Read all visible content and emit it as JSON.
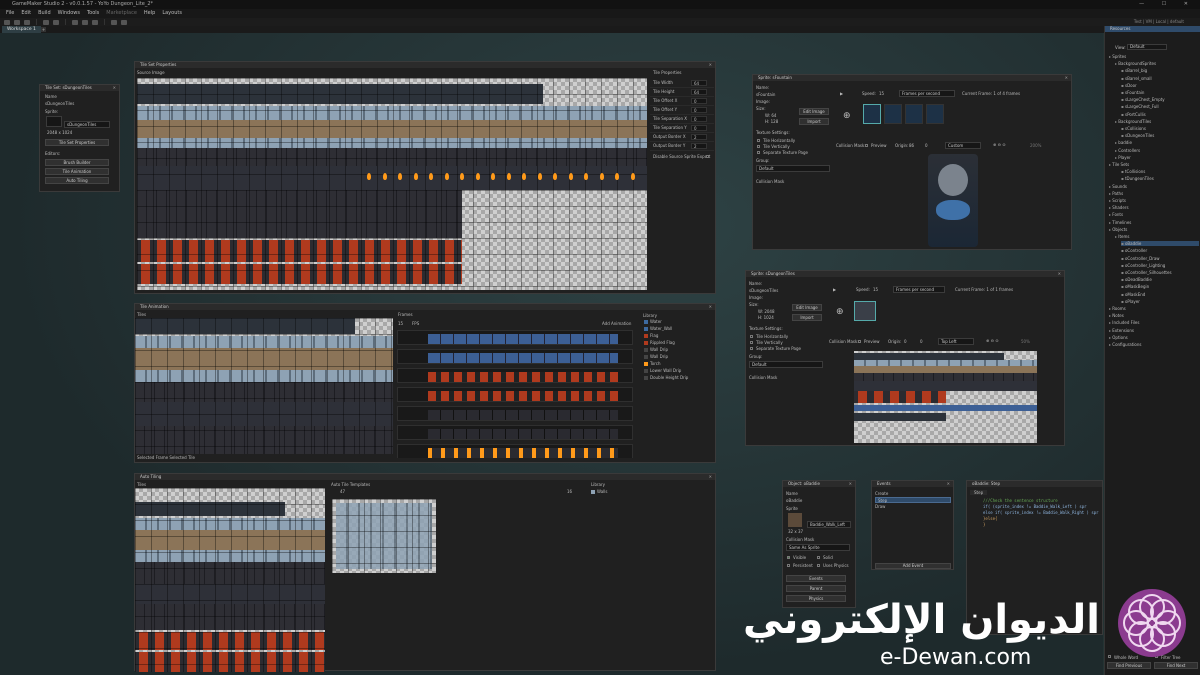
{
  "app": {
    "title": "GameMaker Studio 2 - v0.0.1.57 - YoYo Dungeon_Lite_2*",
    "window_controls": "— ☐ ✕",
    "right_info": "Test | VM | Local | default"
  },
  "menu": [
    "File",
    "Edit",
    "Build",
    "Windows",
    "Tools",
    "Marketplace",
    "Help",
    "Layouts"
  ],
  "workspace_tab": "Workspace 1",
  "tile_set": {
    "title": "Tile Set: sDungeonTiles",
    "name_label": "Name",
    "name": "sDungeonTiles",
    "sprite_label": "Sprite:",
    "sprite_value": "sDungeonTiles",
    "size": "2048 x 1024",
    "props_button": "Tile Set Properties",
    "editors_label": "Editors:",
    "editors": [
      "Brush Builder",
      "Tile Animation",
      "Auto Tiling"
    ]
  },
  "tsprops": {
    "title": "Tile Set Properties",
    "source_label": "Source Image",
    "props_header": "Tile Properties",
    "props": [
      {
        "label": "Tile Width",
        "value": "64"
      },
      {
        "label": "Tile Height",
        "value": "64"
      },
      {
        "label": "Tile Offset X",
        "value": "0"
      },
      {
        "label": "Tile Offset Y",
        "value": "0"
      },
      {
        "label": "Tile Separation X",
        "value": "0"
      },
      {
        "label": "Tile Separation Y",
        "value": "0"
      },
      {
        "label": "Output Border X",
        "value": "2"
      },
      {
        "label": "Output Border Y",
        "value": "2"
      }
    ],
    "disable_label": "Disable Source Sprite Export"
  },
  "tileanim": {
    "title": "Tile Animation",
    "tiles_label": "Tiles",
    "frames_label": "Frames",
    "fps_value": "15",
    "fps_label": "FPS",
    "add_anim": "Add Animation",
    "library_label": "Library",
    "library": [
      "Water",
      "Water_Wall",
      "Flag",
      "Rippled Flag",
      "Wall Drip",
      "Wall Drip",
      "Torch",
      "Lower Wall Drip",
      "Double Height Drip"
    ],
    "footer": "Selected Frame   Selected Tile"
  },
  "autotile": {
    "title": "Auto Tiling",
    "tiles_label": "Tiles",
    "templates_label": "Auto Tile Templates",
    "library_label": "Library",
    "library": [
      "Walls"
    ],
    "count_a": "47",
    "count_b": "16"
  },
  "sprite_fountain": {
    "title": "Sprite: sFountain",
    "name_label": "Name:",
    "name": "sFountain",
    "image_label": "Image:",
    "size_label": "Size:",
    "w": "W: 64",
    "h": "H: 128",
    "edit_button": "Edit Image",
    "import_button": "Import",
    "texture_label": "Texture Settings:",
    "texture_opts": [
      "Tile Horizontally",
      "Tile Vertically",
      "Separate Texture Page"
    ],
    "group_label": "Group:",
    "group_value": "Default",
    "collision_label": "Collision Mask",
    "speed_label": "Speed:",
    "speed_value": "15",
    "speed_unit": "Frames per second",
    "current_frame": "Current Frame: 1 of 4 frames",
    "coll_mask": "Collision Mask:",
    "preview": "Preview",
    "origin": "Origin:",
    "ox": "86",
    "oy": "0",
    "origin_mode": "Custom",
    "zoom": "200%"
  },
  "sprite_tiles": {
    "title": "Sprite: sDungeonTiles",
    "name_label": "Name:",
    "name": "sDungeonTiles",
    "image_label": "Image:",
    "size_label": "Size:",
    "w": "W: 2048",
    "h": "H: 1024",
    "edit_button": "Edit Image",
    "import_button": "Import",
    "texture_label": "Texture Settings:",
    "texture_opts": [
      "Tile Horizontally",
      "Tile Vertically",
      "Separate Texture Page"
    ],
    "group_label": "Group:",
    "group_value": "Default",
    "collision_label": "Collision Mask",
    "speed_label": "Speed:",
    "speed_value": "15",
    "speed_unit": "Frames per second",
    "current_frame": "Current Frame: 1 of 1 frames",
    "coll_mask": "Collision Mask:",
    "preview": "Preview",
    "origin": "Origin:",
    "ox": "0",
    "oy": "0",
    "origin_mode": "Top Left",
    "zoom": "50%"
  },
  "object": {
    "title": "Object: oBaddie",
    "name_label": "Name",
    "name": "oBaddie",
    "sprite_label": "Sprite",
    "sprite_value": "Baddie_Walk_Left",
    "size": "32 x 37",
    "mask_label": "Collision Mask",
    "mask_value": "Same As Sprite",
    "checks": [
      "Visible",
      "Solid",
      "Persistent",
      "Uses Physics"
    ],
    "buttons": [
      "Events",
      "Parent",
      "Physics"
    ]
  },
  "events": {
    "title": "Events",
    "items": [
      "Create",
      "Step",
      "Draw"
    ],
    "add_button": "Add Event"
  },
  "code": {
    "title": "oBaddie: Step",
    "tab": "Step",
    "lines": [
      "///Check the sentence structure",
      "if(   (sprite_index != Baddie_Walk_Left ) spr",
      "else if(  sprite_index != Baddie_Walk_Right ) spr",
      "}else{",
      "}"
    ]
  },
  "resources": {
    "header": "Resources",
    "view_label": "View:",
    "view_value": "Default",
    "items": [
      {
        "t": "Sprites",
        "i": 0
      },
      {
        "t": "BackgroundSprites",
        "i": 1
      },
      {
        "t": "sBarrel_big",
        "i": 2
      },
      {
        "t": "sBarrel_small",
        "i": 2
      },
      {
        "t": "sDoor",
        "i": 2
      },
      {
        "t": "sFountain",
        "i": 2
      },
      {
        "t": "sLargeChest_Empty",
        "i": 2
      },
      {
        "t": "sLargeChest_Full",
        "i": 2
      },
      {
        "t": "sPortCullis",
        "i": 2
      },
      {
        "t": "BackgroundTiles",
        "i": 1
      },
      {
        "t": "sCollisions",
        "i": 2
      },
      {
        "t": "sDungeonTiles",
        "i": 2
      },
      {
        "t": "baddie",
        "i": 1
      },
      {
        "t": "Controllers",
        "i": 1
      },
      {
        "t": "Player",
        "i": 1
      },
      {
        "t": "Tile Sets",
        "i": 0
      },
      {
        "t": "tCollisions",
        "i": 2
      },
      {
        "t": "tDungeonTiles",
        "i": 2
      },
      {
        "t": "Sounds",
        "i": 0
      },
      {
        "t": "Paths",
        "i": 0
      },
      {
        "t": "Scripts",
        "i": 0
      },
      {
        "t": "Shaders",
        "i": 0
      },
      {
        "t": "Fonts",
        "i": 0
      },
      {
        "t": "Timelines",
        "i": 0
      },
      {
        "t": "Objects",
        "i": 0
      },
      {
        "t": "Items",
        "i": 1
      },
      {
        "t": "oBaddie",
        "i": 2
      },
      {
        "t": "oController",
        "i": 2
      },
      {
        "t": "oController_Draw",
        "i": 2
      },
      {
        "t": "oController_Lighting",
        "i": 2
      },
      {
        "t": "oController_Silhouettes",
        "i": 2
      },
      {
        "t": "oDeadBaddie",
        "i": 2
      },
      {
        "t": "oMaskBegin",
        "i": 2
      },
      {
        "t": "oMaskEnd",
        "i": 2
      },
      {
        "t": "oPlayer",
        "i": 2
      },
      {
        "t": "Rooms",
        "i": 0
      },
      {
        "t": "Notes",
        "i": 0
      },
      {
        "t": "Included Files",
        "i": 0
      },
      {
        "t": "Extensions",
        "i": 0
      },
      {
        "t": "Options",
        "i": 0
      },
      {
        "t": "Configurations",
        "i": 0
      }
    ],
    "footer_checks": [
      "Whole Word",
      "Filter Tree"
    ],
    "find_prev": "Find Previous",
    "find_next": "Find Next"
  },
  "watermark": {
    "arabic": "الديوان الإلكتروني",
    "url": "e-Dewan.com"
  },
  "colors": {
    "canvas": "#243434",
    "panel": "#202020",
    "accent": "#2f4b6a",
    "torch": "#ff9a1a"
  }
}
